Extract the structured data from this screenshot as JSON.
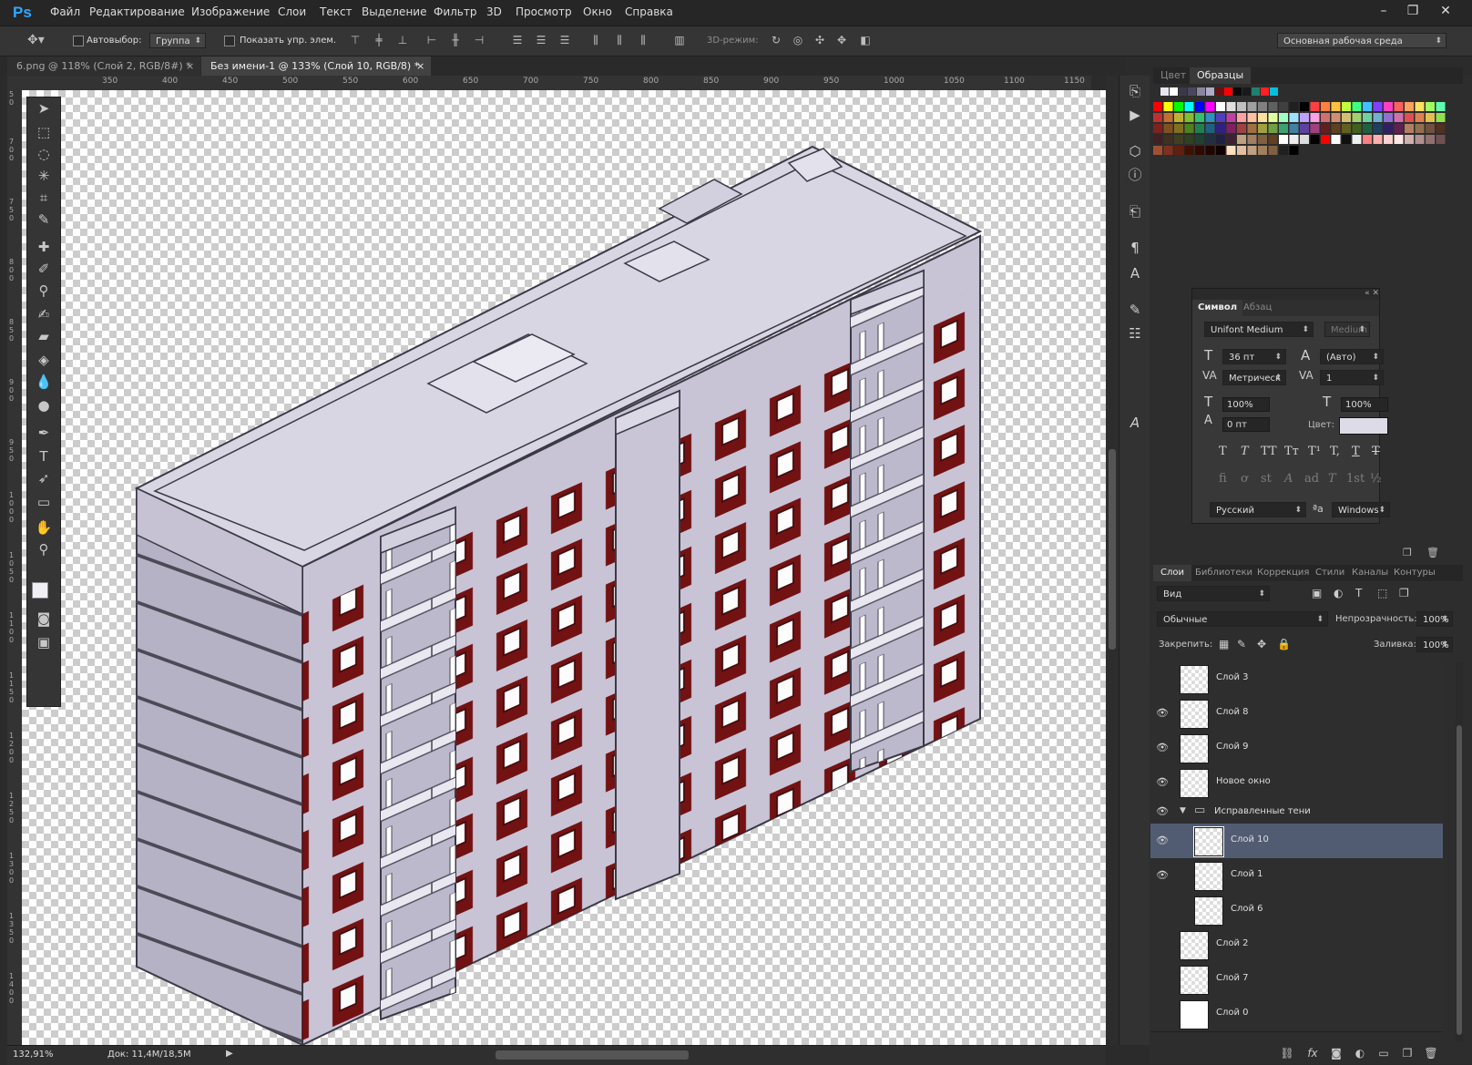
{
  "app": {
    "logo": "Ps"
  },
  "menu": [
    "Файл",
    "Редактирование",
    "Изображение",
    "Слои",
    "Текст",
    "Выделение",
    "Фильтр",
    "3D",
    "Просмотр",
    "Окно",
    "Справка"
  ],
  "window": {
    "minimize": "–",
    "restore": "❐",
    "close": "✕"
  },
  "options": {
    "autoselect": "Автовыбор:",
    "group": "Группа",
    "show_controls": "Показать упр. элем.",
    "mode3d": "3D-режим:",
    "workspace": "Основная рабочая среда"
  },
  "tabs": [
    {
      "label": "6.png @ 118% (Слой 2, RGB/8#) *",
      "close": "×"
    },
    {
      "label": "Без имени-1 @ 133% (Слой 10, RGB/8) *",
      "close": "×"
    }
  ],
  "ruler": {
    "h": [
      "350",
      "400",
      "450",
      "500",
      "550",
      "600",
      "650",
      "700",
      "750",
      "800",
      "850",
      "900",
      "950",
      "1000",
      "1050",
      "1100",
      "1150"
    ],
    "v": [
      "5\n0",
      "7\n0\n0",
      "7\n5\n0",
      "8\n0\n0",
      "8\n5\n0",
      "9\n0\n0",
      "9\n5\n0",
      "1\n0\n0\n0",
      "1\n0\n5\n0",
      "1\n1\n0\n0",
      "1\n1\n5\n0",
      "1\n2\n0\n0",
      "1\n2\n5\n0",
      "1\n3\n0\n0",
      "1\n3\n5\n0",
      "1\n4\n0\n0"
    ]
  },
  "status": {
    "zoom": "132,91%",
    "doc": "Док: 11,4M/18,5M"
  },
  "swatch_panel": {
    "tabs": [
      "Цвет",
      "Образцы"
    ]
  },
  "character": {
    "tabs": [
      "Символ",
      "Абзац"
    ],
    "font_family": "Unifont Medium",
    "font_style": "Medium",
    "size": "36 пт",
    "leading": "(Авто)",
    "kerning": "Метрическ",
    "tracking": "1",
    "vscale": "100%",
    "hscale": "100%",
    "baseline": "0 пт",
    "color_label": "Цвет:",
    "styles": [
      "T",
      "T",
      "TT",
      "Tт",
      "T¹",
      "T,",
      "T",
      "T"
    ],
    "opentype": [
      "fi",
      "ơ",
      "st",
      "A",
      "ad",
      "T",
      "1st",
      "½"
    ],
    "language": "Русский",
    "aa_icon": "ªa",
    "aa": "Windows"
  },
  "layers_panel": {
    "tabs": [
      "Слои",
      "Библиотеки",
      "Коррекция",
      "Стили",
      "Каналы",
      "Контуры"
    ],
    "filter": "Вид",
    "blend": "Обычные",
    "opacity_label": "Непрозрачность:",
    "opacity": "100%",
    "lock_label": "Закрепить:",
    "fill_label": "Заливка:",
    "fill": "100%",
    "layers": [
      {
        "name": "Слой 3",
        "visible": false,
        "indent": false,
        "selected": false
      },
      {
        "name": "Слой 8",
        "visible": true,
        "indent": false,
        "selected": false
      },
      {
        "name": "Слой 9",
        "visible": true,
        "indent": false,
        "selected": false
      },
      {
        "name": "Новое окно",
        "visible": true,
        "indent": false,
        "selected": false
      },
      {
        "name": "Исправленные тени",
        "visible": true,
        "group": true
      },
      {
        "name": "Слой 10",
        "visible": true,
        "indent": true,
        "selected": true
      },
      {
        "name": "Слой 1",
        "visible": true,
        "indent": true,
        "selected": false
      },
      {
        "name": "Слой 6",
        "visible": false,
        "indent": true,
        "selected": false
      },
      {
        "name": "Слой 2",
        "visible": false,
        "indent": false,
        "selected": false
      },
      {
        "name": "Слой 7",
        "visible": false,
        "indent": false,
        "selected": false
      },
      {
        "name": "Слой 0",
        "visible": false,
        "indent": false,
        "selected": false,
        "white": true
      }
    ]
  },
  "colors": {
    "accent": "#31a8ff",
    "building_top": "#d8d5e3",
    "building_side": "#c2bed0",
    "building_dark": "#a9a5b8",
    "window_red": "#7a0a0a",
    "selected_row": "#515c73"
  }
}
